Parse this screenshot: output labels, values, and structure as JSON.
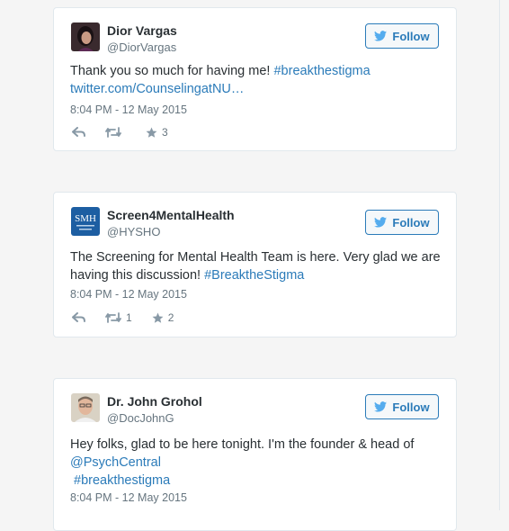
{
  "follow_label": "Follow",
  "tweets": [
    {
      "name": "Dior Vargas",
      "handle": "@DiorVargas",
      "text": "Thank you so much for having me! ",
      "hashtag": "#breakthestigma",
      "link": "twitter.com/CounselingatNU…",
      "timestamp": "8:04 PM - 12 May 2015",
      "retweets": "",
      "favorites": "3"
    },
    {
      "name": "Screen4MentalHealth",
      "handle": "@HYSHO",
      "avatar_text": "SMH",
      "text": "The Screening for Mental Health Team is here. Very glad we are having this discussion! ",
      "hashtag": "#BreaktheStigma",
      "timestamp": "8:04 PM - 12 May 2015",
      "retweets": "1",
      "favorites": "2"
    },
    {
      "name": "Dr. John Grohol",
      "handle": "@DocJohnG",
      "text": "Hey folks, glad to be here tonight. I'm the founder & head of",
      "mention": "@PsychCentral",
      "hashtag": "#breakthestigma",
      "timestamp": "8:04 PM - 12 May 2015"
    }
  ],
  "colors": {
    "link": "#2b7bb9",
    "text": "#292f33",
    "muted": "#66757f",
    "border": "#e1e8ed"
  }
}
